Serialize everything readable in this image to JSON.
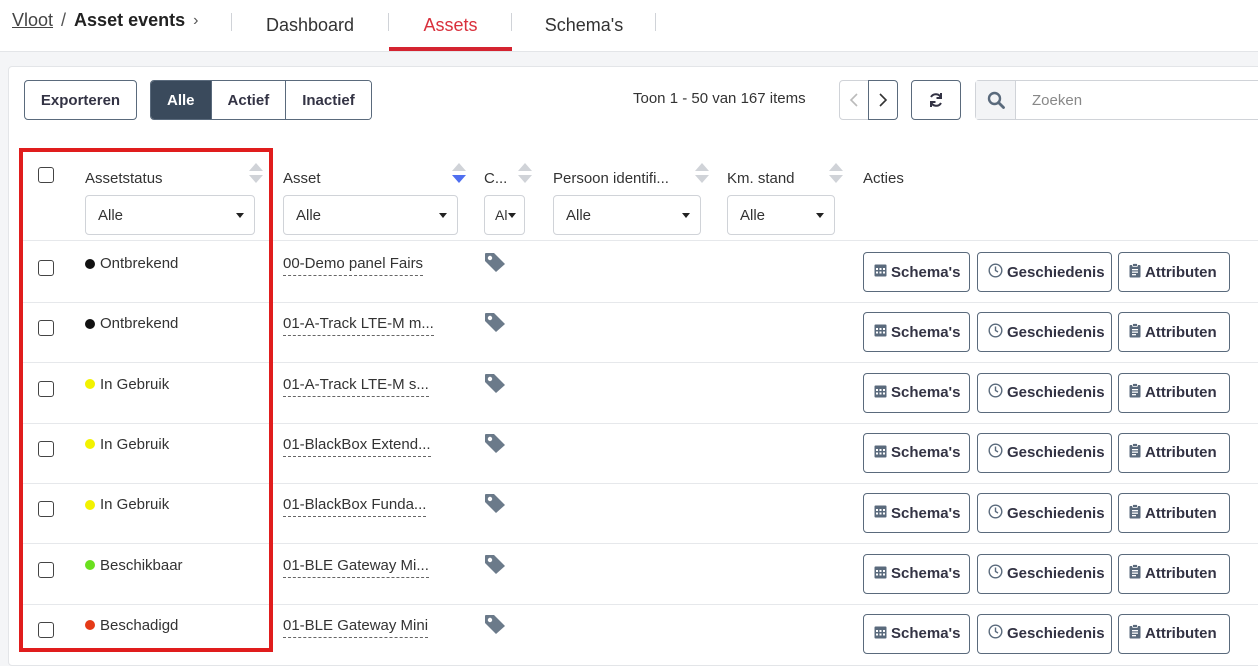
{
  "breadcrumb": {
    "root": "Vloot",
    "separator": "/",
    "current": "Asset events",
    "chevron": "›"
  },
  "tabs": [
    {
      "label": "Dashboard",
      "active": false
    },
    {
      "label": "Assets",
      "active": true
    },
    {
      "label": "Schema's",
      "active": false
    }
  ],
  "toolbar": {
    "export_label": "Exporteren",
    "filters": [
      {
        "label": "Alle",
        "active": true
      },
      {
        "label": "Actief",
        "active": false
      },
      {
        "label": "Inactief",
        "active": false
      }
    ],
    "page_info": "Toon 1 - 50 van 167 items",
    "search_placeholder": "Zoeken"
  },
  "columns": {
    "status": "Assetstatus",
    "asset": "Asset",
    "c": "C...",
    "person": "Persoon identifi...",
    "km": "Km. stand",
    "actions": "Acties"
  },
  "filters": {
    "status": "Alle",
    "asset": "Alle",
    "c": "Al",
    "person": "Alle",
    "km": "Alle"
  },
  "actions": {
    "schema": "Schema's",
    "history": "Geschiedenis",
    "attributes": "Attributen"
  },
  "rows": [
    {
      "status": "Ontbrekend",
      "status_color": "#111111",
      "asset": "00-Demo panel Fairs"
    },
    {
      "status": "Ontbrekend",
      "status_color": "#111111",
      "asset": "01-A-Track LTE-M m..."
    },
    {
      "status": "In Gebruik",
      "status_color": "#f2f200",
      "asset": "01-A-Track LTE-M s..."
    },
    {
      "status": "In Gebruik",
      "status_color": "#f2f200",
      "asset": "01-BlackBox Extend..."
    },
    {
      "status": "In Gebruik",
      "status_color": "#f2f200",
      "asset": "01-BlackBox Funda..."
    },
    {
      "status": "Beschikbaar",
      "status_color": "#6ae01e",
      "asset": "01-BLE Gateway Mi..."
    },
    {
      "status": "Beschadigd",
      "status_color": "#e53a17",
      "asset": "01-BLE Gateway Mini"
    }
  ],
  "colors": {
    "accent": "#d42330",
    "highlight": "#e01d1d",
    "primary_dark": "#3a4a5c"
  }
}
